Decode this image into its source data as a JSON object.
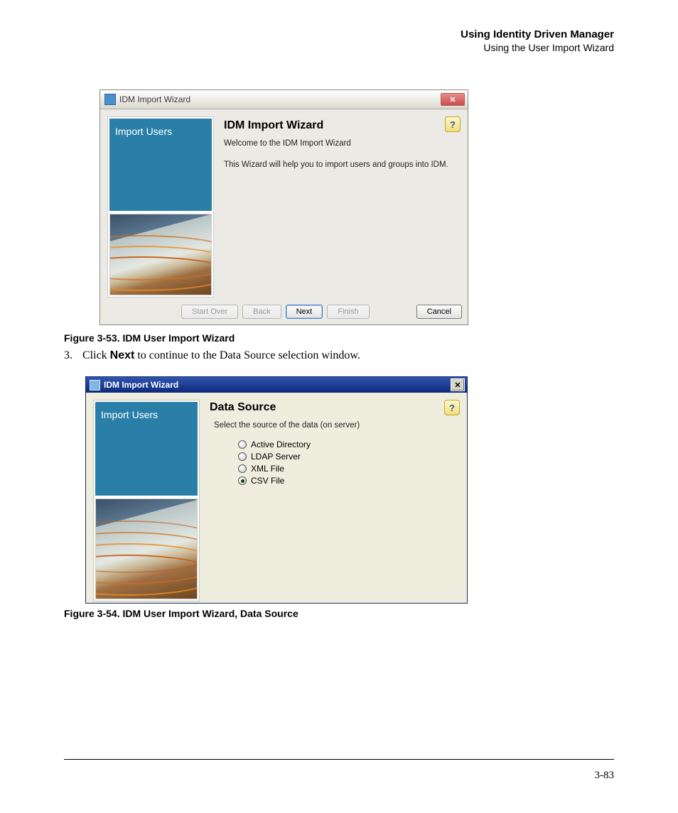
{
  "header": {
    "title": "Using Identity Driven Manager",
    "subtitle": "Using the User Import Wizard"
  },
  "figure1": {
    "caption": "Figure 3-53. IDM User Import Wizard",
    "window_title": "IDM Import Wizard",
    "side_title": "Import Users",
    "heading": "IDM Import Wizard",
    "welcome": "Welcome to the IDM Import Wizard",
    "description": "This Wizard will help you to import users and groups into IDM.",
    "buttons": {
      "start_over": "Start Over",
      "back": "Back",
      "next": "Next",
      "finish": "Finish",
      "cancel": "Cancel"
    }
  },
  "step_text": {
    "number": "3.",
    "pre": "Click ",
    "bold": "Next",
    "post": " to continue to the Data Source selection window."
  },
  "figure2": {
    "caption": "Figure 3-54. IDM User Import Wizard, Data Source",
    "window_title": "IDM Import Wizard",
    "side_title": "Import Users",
    "heading": "Data Source",
    "prompt": "Select the source of the data (on server)",
    "options": [
      {
        "label": "Active Directory",
        "selected": false
      },
      {
        "label": "LDAP Server",
        "selected": false
      },
      {
        "label": "XML File",
        "selected": false
      },
      {
        "label": "CSV File",
        "selected": true
      }
    ]
  },
  "page_number": "3-83",
  "help_glyph": "?"
}
